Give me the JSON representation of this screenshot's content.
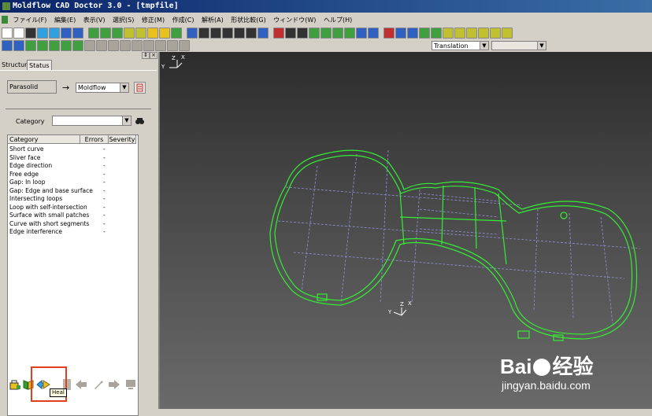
{
  "window": {
    "title": "Moldflow CAD Doctor 3.0 - [tmpfile]"
  },
  "menu": [
    "ファイル(F)",
    "編集(E)",
    "表示(V)",
    "選択(S)",
    "修正(M)",
    "作成(C)",
    "解析(A)",
    "形状比較(G)",
    "ウィンドウ(W)",
    "ヘルプ(H)"
  ],
  "toolbar": {
    "transform_mode": "Translation"
  },
  "panel": {
    "tabs": {
      "structure": "Structure",
      "status": "Status"
    },
    "source_format": "Parasolid",
    "arrow": "→",
    "target_format": "Moldflow",
    "category_label": "Category",
    "category_value": "",
    "list": {
      "headers": {
        "category": "Category",
        "errors": "Errors",
        "severity": "Severity"
      },
      "rows": [
        {
          "category": "Short curve",
          "errors": "-"
        },
        {
          "category": "Sliver face",
          "errors": "-"
        },
        {
          "category": "Edge direction",
          "errors": "-"
        },
        {
          "category": "Free edge",
          "errors": "-"
        },
        {
          "category": "Gap: In loop",
          "errors": "-"
        },
        {
          "category": "Gap: Edge and base surface",
          "errors": "-"
        },
        {
          "category": "Intersecting loops",
          "errors": "-"
        },
        {
          "category": "Loop with self-intersection",
          "errors": "-"
        },
        {
          "category": "Surface with small patches",
          "errors": "-"
        },
        {
          "category": "Curve with short segments",
          "errors": "-"
        },
        {
          "category": "Edge interference",
          "errors": "-"
        }
      ]
    },
    "tooltip": "Heal"
  },
  "viewport": {
    "triad_top": {
      "x": "Y",
      "y": "Z",
      "z": "X"
    },
    "triad_center": {
      "x": "Y",
      "y": "Z",
      "z": "X"
    }
  },
  "watermark": {
    "brand": "Bai",
    "brand2": "经验",
    "url": "jingyan.baidu.com"
  },
  "colors": {
    "mesh": "#33ee33",
    "grid": "#9090d8",
    "highlight": "#e04020",
    "title": "#0a246a"
  }
}
